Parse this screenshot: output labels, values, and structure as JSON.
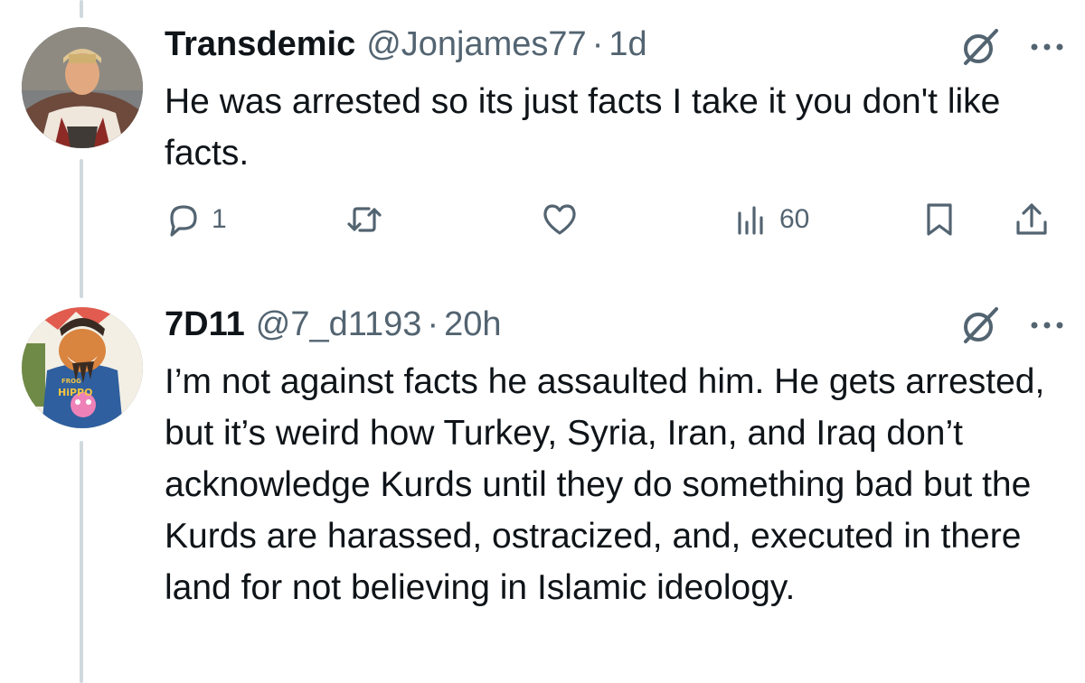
{
  "tweets": [
    {
      "name": "Transdemic",
      "handle": "@Jonjames77",
      "separator": "·",
      "time": "1d",
      "text": "He was arrested so its just facts I take it you don't like facts.",
      "actions": {
        "replies": "1",
        "reposts": "",
        "likes": "",
        "views": "60"
      }
    },
    {
      "name": "7D11",
      "handle": "@7_d1193",
      "separator": "·",
      "time": "20h",
      "text": "I’m not against facts he assaulted him. He gets arrested, but it’s weird how Turkey, Syria, Iran, and Iraq don’t acknowledge Kurds until they do something bad but the Kurds are harassed, ostracized, and, executed in there land for not believing in Islamic ideology.",
      "avatar_text": [
        "FROG",
        "HiPPO"
      ]
    }
  ],
  "icons": {
    "reply": "reply-icon",
    "repost": "repost-icon",
    "like": "heart-icon",
    "views": "views-icon",
    "bookmark": "bookmark-icon",
    "share": "share-icon",
    "grok": "grok-icon",
    "more": "more-icon"
  },
  "colors": {
    "text": "#0f1419",
    "secondary": "#536471",
    "thread_line": "#cfd9de"
  }
}
